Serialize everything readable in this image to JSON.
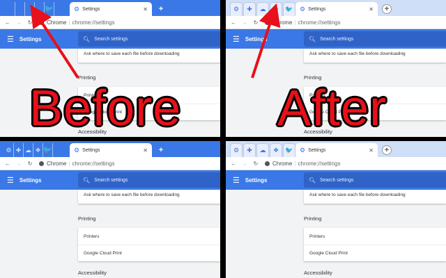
{
  "before": {
    "caption": "Before",
    "tab": {
      "title": "Settings"
    },
    "toolbar": {
      "site": "Chrome",
      "url": "chrome://settings"
    },
    "appbar": {
      "title": "Settings"
    },
    "search": {
      "placeholder": "Search settings"
    },
    "content": {
      "ask_row": "Ask where to save each file before downloading",
      "printing_heading": "Printing",
      "printers": "Printers",
      "cloud_print": "Google Cloud Print",
      "accessibility_heading": "Accessibility"
    }
  },
  "after": {
    "caption": "After",
    "tab": {
      "title": "Settings"
    },
    "toolbar": {
      "site": "Chrome",
      "url": "chrome://settings"
    },
    "appbar": {
      "title": "Settings"
    },
    "search": {
      "placeholder": "Search settings"
    },
    "content": {
      "ask_row": "Ask where to save each file before downloading",
      "printing_heading": "Printing",
      "printers": "Printers",
      "cloud_print": "Google Cloud Print",
      "accessibility_heading": "Accessibility"
    }
  },
  "icons": {
    "pinned_tabs": [
      "settings-icon",
      "puzzle-icon",
      "cloud-icon",
      "dropbox-icon",
      "twitter-icon"
    ],
    "arrow": "red-arrow"
  },
  "colors": {
    "chrome_blue": "#3b78e7",
    "after_tabstrip": "#cfdff8",
    "caption_red": "#e8101a"
  }
}
